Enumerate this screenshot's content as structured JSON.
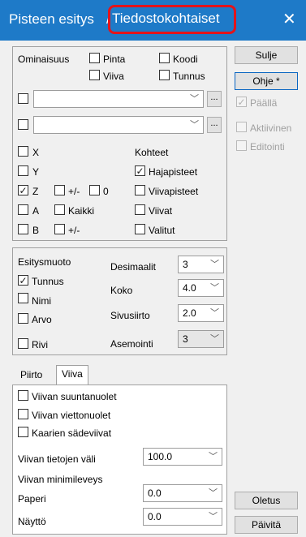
{
  "window": {
    "title_main": "Pisteen esitys",
    "title_separator": "/",
    "title_highlighted": "Tiedostokohtaiset",
    "close_glyph": "✕"
  },
  "top_panel": {
    "ominaisuus_label": "Ominaisuus",
    "pinta": "Pinta",
    "koodi": "Koodi",
    "viiva": "Viiva",
    "tunnus": "Tunnus",
    "combo1_value": "",
    "combo2_value": "",
    "ellipsis": "...",
    "x": "X",
    "y": "Y",
    "z": "Z",
    "pm": "+/-",
    "zero": "0",
    "a": "A",
    "kaikki": "Kaikki",
    "b": "B",
    "pm2": "+/-",
    "kohteet_label": "Kohteet",
    "hajapisteet": "Hajapisteet",
    "viivapisteet": "Viivapisteet",
    "viivat": "Viivat",
    "valitut": "Valitut"
  },
  "mid_panel": {
    "esitysmuoto_label": "Esitysmuoto",
    "tunnus": "Tunnus",
    "nimi": "Nimi",
    "arvo": "Arvo",
    "rivi": "Rivi",
    "desimaalit_label": "Desimaalit",
    "desimaalit_value": "3",
    "koko_label": "Koko",
    "koko_value": "4.0",
    "sivusiirto_label": "Sivusiirto",
    "sivusiirto_value": "2.0",
    "asemointi_label": "Asemointi",
    "asemointi_value": "3"
  },
  "tabs": {
    "piirto": "Piirto",
    "viiva": "Viiva"
  },
  "bottom_panel": {
    "suuntanuolet": "Viivan suuntanuolet",
    "viettonuolet": "Viivan viettonuolet",
    "sadeviivat": "Kaarien sädeviivat",
    "tietojen_vali_label": "Viivan tietojen väli",
    "tietojen_vali_value": "100.0",
    "minimileveys_label": "Viivan minimileveys",
    "paperi_label": "Paperi",
    "paperi_value": "0.0",
    "naytto_label": "Näyttö",
    "naytto_value": "0.0"
  },
  "side": {
    "sulje": "Sulje",
    "ohje": "Ohje *",
    "paalla": "Päällä",
    "aktiivinen": "Aktiivinen",
    "editointi": "Editointi",
    "oletus": "Oletus",
    "paivita": "Päivitä"
  },
  "glyphs": {
    "check": "✓",
    "chevron": "﹀"
  },
  "icons": {
    "checkmark": "checkmark-icon",
    "chevron": "chevron-down-icon",
    "close": "close-icon"
  },
  "colors": {
    "titlebar": "#1e7ac8",
    "highlight_border": "#e3141b"
  }
}
